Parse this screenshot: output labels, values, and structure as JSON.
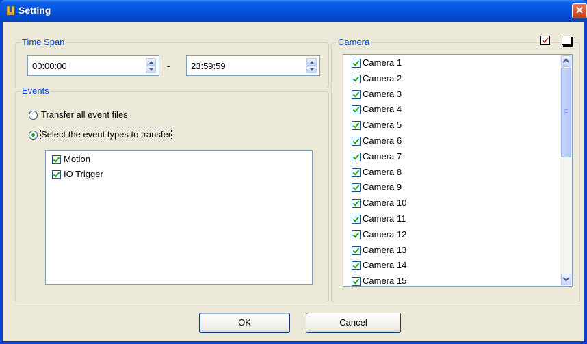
{
  "window": {
    "title": "Setting",
    "close_symbol": "✕"
  },
  "time_span": {
    "legend": "Time Span",
    "start": "00:00:00",
    "separator": "-",
    "end": "23:59:59"
  },
  "events": {
    "legend": "Events",
    "option_all": "Transfer all event files",
    "option_select": "Select the event types to transfer",
    "selected_option": "select",
    "types": [
      {
        "label": "Motion",
        "checked": true
      },
      {
        "label": "IO Trigger",
        "checked": true
      }
    ]
  },
  "camera": {
    "legend": "Camera",
    "check_all_icon": "check-all-icon",
    "uncheck_all_icon": "uncheck-all-icon",
    "items": [
      {
        "label": "Camera 1",
        "checked": true
      },
      {
        "label": "Camera 2",
        "checked": true
      },
      {
        "label": "Camera 3",
        "checked": true
      },
      {
        "label": "Camera 4",
        "checked": true
      },
      {
        "label": "Camera 5",
        "checked": true
      },
      {
        "label": "Camera 6",
        "checked": true
      },
      {
        "label": "Camera 7",
        "checked": true
      },
      {
        "label": "Camera 8",
        "checked": true
      },
      {
        "label": "Camera 9",
        "checked": true
      },
      {
        "label": "Camera 10",
        "checked": true
      },
      {
        "label": "Camera 11",
        "checked": true
      },
      {
        "label": "Camera 12",
        "checked": true
      },
      {
        "label": "Camera 13",
        "checked": true
      },
      {
        "label": "Camera 14",
        "checked": true
      },
      {
        "label": "Camera 15",
        "checked": true
      }
    ]
  },
  "buttons": {
    "ok": "OK",
    "cancel": "Cancel"
  },
  "colors": {
    "titlebar": "#0553dc",
    "legend": "#0046d5",
    "check": "#21a121"
  }
}
